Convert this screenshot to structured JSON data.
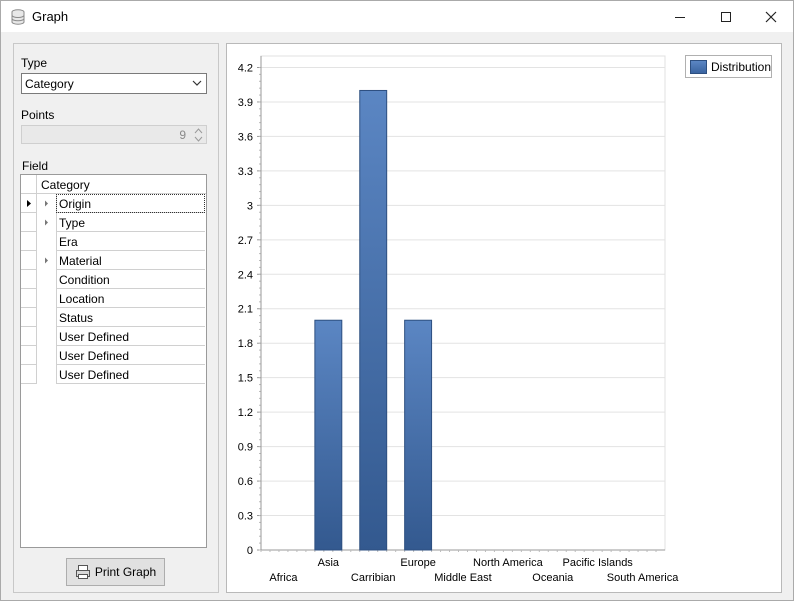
{
  "window": {
    "title": "Graph",
    "minimize_icon": "minimize-icon",
    "maximize_icon": "maximize-icon",
    "close_icon": "close-icon"
  },
  "left": {
    "type_label": "Type",
    "type_value": "Category",
    "points_label": "Points",
    "points_value": "9",
    "field_label": "Field",
    "grid_header": "Category",
    "fields": [
      {
        "label": "Origin",
        "expandable": true,
        "current": true
      },
      {
        "label": "Type",
        "expandable": true,
        "current": false
      },
      {
        "label": "Era",
        "expandable": false,
        "current": false
      },
      {
        "label": "Material",
        "expandable": true,
        "current": false
      },
      {
        "label": "Condition",
        "expandable": false,
        "current": false
      },
      {
        "label": "Location",
        "expandable": false,
        "current": false
      },
      {
        "label": "Status",
        "expandable": false,
        "current": false
      },
      {
        "label": "User Defined",
        "expandable": false,
        "current": false
      },
      {
        "label": "User Defined",
        "expandable": false,
        "current": false
      },
      {
        "label": "User Defined",
        "expandable": false,
        "current": false
      }
    ],
    "print_button": "Print Graph"
  },
  "colors": {
    "bar_top": "#5b86c3",
    "bar_bottom": "#33598f",
    "bar_border": "#2d4f80"
  },
  "chart_data": {
    "type": "bar",
    "categories": [
      "Africa",
      "Asia",
      "Carribian",
      "Europe",
      "Middle East",
      "North America",
      "Oceania",
      "Pacific Islands",
      "South America"
    ],
    "series": [
      {
        "name": "Distribution",
        "values": [
          0,
          2,
          4,
          2,
          0,
          0,
          0,
          0,
          0
        ]
      }
    ],
    "ylim": [
      0,
      4.3
    ],
    "yticks": [
      0,
      0.3,
      0.6,
      0.9,
      1.2,
      1.5,
      1.8,
      2.1,
      2.4,
      2.7,
      3,
      3.3,
      3.6,
      3.9,
      4.2
    ],
    "grid": true,
    "legend": "top-right",
    "title": "",
    "xlabel": "",
    "ylabel": ""
  }
}
